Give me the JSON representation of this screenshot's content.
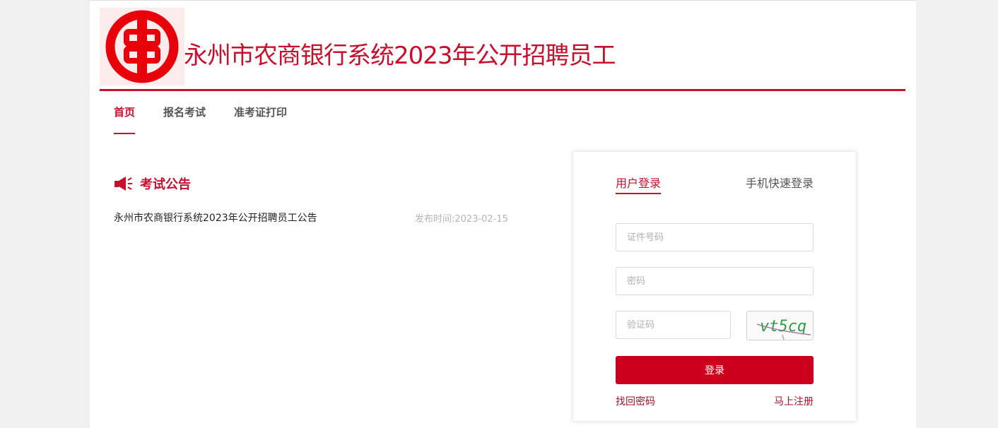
{
  "header": {
    "site_title": "永州市农商银行系统2023年公开招聘员工",
    "logo_icon": "bank-coin-logo",
    "accent_color": "#c8102e"
  },
  "nav": {
    "items": [
      {
        "label": "首页",
        "active": true
      },
      {
        "label": "报名考试",
        "active": false
      },
      {
        "label": "准考证打印",
        "active": false
      }
    ]
  },
  "notice": {
    "icon": "megaphone-icon",
    "title": "考试公告",
    "items": [
      {
        "title": "永州市农商银行系统2023年公开招聘员工公告",
        "date": "发布时间:2023-02-15"
      }
    ]
  },
  "login": {
    "tabs": [
      {
        "label": "用户登录",
        "active": true
      },
      {
        "label": "手机快速登录",
        "active": false
      }
    ],
    "id_placeholder": "证件号码",
    "password_placeholder": "密码",
    "captcha_placeholder": "验证码",
    "captcha_text": "vt5cq",
    "submit_label": "登录",
    "forgot_label": "找回密码",
    "register_label": "马上注册",
    "button_color": "#cc001c"
  }
}
